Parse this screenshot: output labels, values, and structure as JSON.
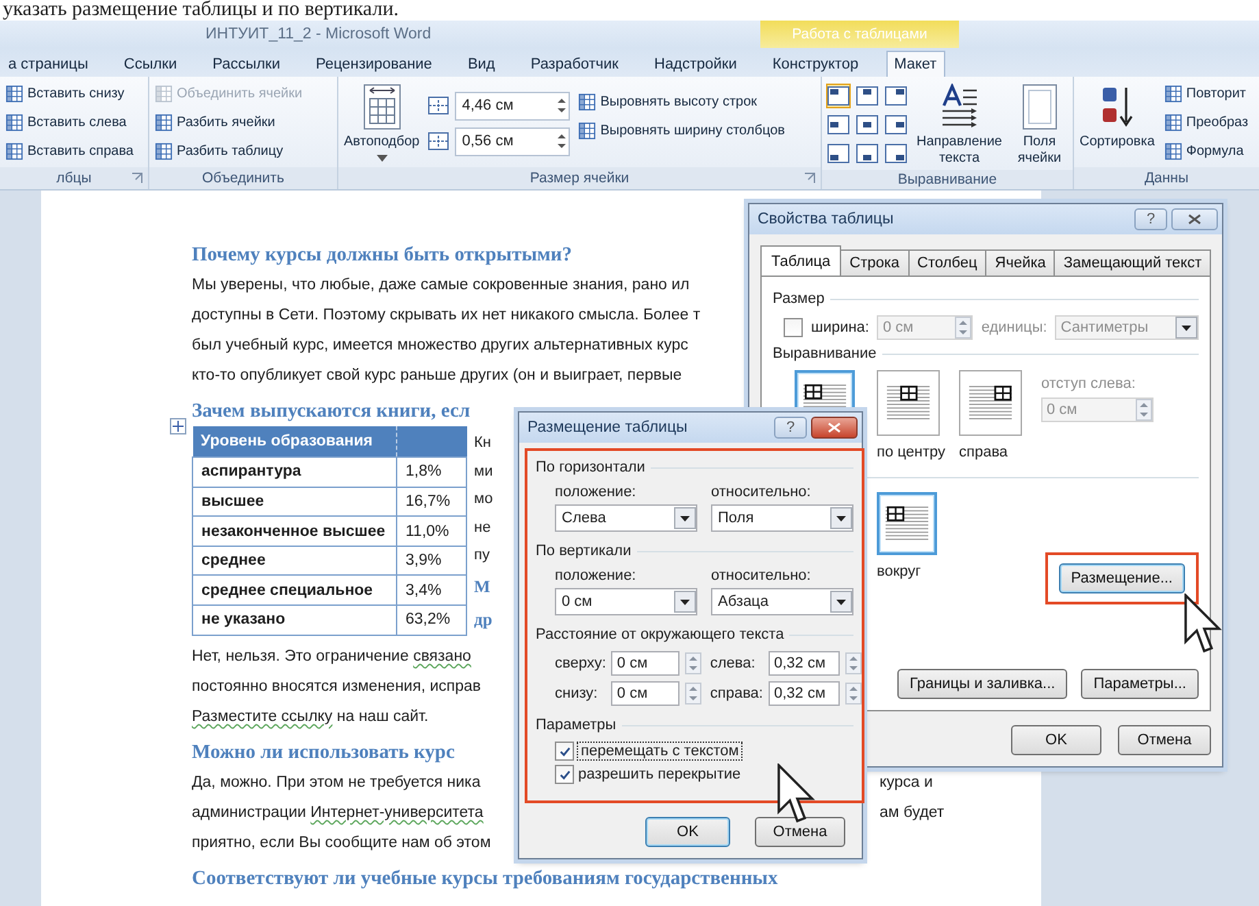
{
  "book_text": "указать размещение таблицы и по вертикали.",
  "window": {
    "title": "ИНТУИТ_11_2 - Microsoft Word",
    "context_group": "Работа с таблицами"
  },
  "tabs": [
    {
      "label": "а страницы",
      "selected": false
    },
    {
      "label": "Ссылки",
      "selected": false
    },
    {
      "label": "Рассылки",
      "selected": false
    },
    {
      "label": "Рецензирование",
      "selected": false
    },
    {
      "label": "Вид",
      "selected": false
    },
    {
      "label": "Разработчик",
      "selected": false
    },
    {
      "label": "Надстройки",
      "selected": false
    },
    {
      "label": "Конструктор",
      "selected": false
    },
    {
      "label": "Макет",
      "selected": true
    }
  ],
  "ribbon": {
    "groups": [
      {
        "label": "лбцы",
        "launcher": true,
        "columns": [
          [
            {
              "kind": "small",
              "label": "Вставить снизу",
              "disabled": false
            },
            {
              "kind": "small",
              "label": "Вставить слева",
              "disabled": false
            },
            {
              "kind": "small",
              "label": "Вставить справа",
              "disabled": false
            }
          ]
        ]
      },
      {
        "label": "Объединить",
        "launcher": false,
        "columns": [
          [
            {
              "kind": "small",
              "label": "Объединить ячейки",
              "disabled": true
            },
            {
              "kind": "small",
              "label": "Разбить ячейки",
              "disabled": false
            },
            {
              "kind": "small",
              "label": "Разбить таблицу",
              "disabled": false
            }
          ]
        ]
      },
      {
        "label": "Размер ячейки",
        "launcher": true,
        "columns": [
          [
            {
              "kind": "large",
              "label": "Автоподбор",
              "dropdown": true
            }
          ],
          [
            {
              "kind": "spinner",
              "value": "4,46 см"
            },
            {
              "kind": "spinner",
              "value": "0,56 см"
            }
          ],
          [
            {
              "kind": "small",
              "label": "Выровнять высоту строк",
              "disabled": false
            },
            {
              "kind": "small",
              "label": "Выровнять ширину столбцов",
              "disabled": false
            }
          ]
        ]
      },
      {
        "label": "Выравнивание",
        "launcher": false,
        "columns": [
          [
            {
              "kind": "align_grid",
              "cells": [
                {
                  "selected": true
                },
                {
                  "selected": false
                },
                {
                  "selected": false
                },
                {
                  "selected": false
                },
                {
                  "selected": false
                },
                {
                  "selected": false
                },
                {
                  "selected": false
                },
                {
                  "selected": false
                },
                {
                  "selected": false
                }
              ]
            }
          ],
          [
            {
              "kind": "large",
              "label": "Направление текста",
              "dropdown": false
            }
          ],
          [
            {
              "kind": "large",
              "label": "Поля ячейки",
              "dropdown": false
            }
          ]
        ]
      },
      {
        "label": "Данны",
        "launcher": false,
        "columns": [
          [
            {
              "kind": "large",
              "label": "Сортировка",
              "dropdown": false
            }
          ],
          [
            {
              "kind": "small",
              "label": "Повторит",
              "disabled": false
            },
            {
              "kind": "small",
              "label": "Преобраз",
              "disabled": false
            },
            {
              "kind": "small",
              "label": "Формула",
              "disabled": false
            }
          ]
        ]
      }
    ]
  },
  "document": {
    "blocks": [
      {
        "kind": "heading",
        "text": "Почему курсы должны быть открытыми?"
      },
      {
        "kind": "paragraph",
        "lines": [
          {
            "segments": [
              {
                "text": "Мы уверены, что любые, даже самые сокровенные знания, рано ил",
                "flagged": false
              }
            ]
          },
          {
            "segments": [
              {
                "text": "доступны в Сети. Поэтому скрывать их нет никакого смысла. Более т",
                "flagged": false
              }
            ]
          },
          {
            "segments": [
              {
                "text": "был учебный курс, имеется множество других альтернативных курс",
                "flagged": false
              }
            ]
          },
          {
            "segments": [
              {
                "text": "кто-то опубликует свой курс раньше других (он и выиграет, первые",
                "flagged": false
              }
            ]
          }
        ]
      },
      {
        "kind": "heading",
        "text": "Зачем выпускаются книги, есл"
      },
      {
        "kind": "table",
        "header": "Уровень образования",
        "rows": [
          {
            "label": "аспирантура",
            "value": "1,8%"
          },
          {
            "label": "высшее",
            "value": "16,7%"
          },
          {
            "label": "незаконченное высшее",
            "value": "11,0%"
          },
          {
            "label": "среднее",
            "value": "3,9%"
          },
          {
            "label": "среднее специальное",
            "value": "3,4%"
          },
          {
            "label": "не указано",
            "value": "63,2%"
          }
        ],
        "side_lines": [
          "Кн",
          "ми",
          "мо",
          "не",
          "пу"
        ],
        "side_heading": [
          "М",
          "др"
        ]
      },
      {
        "kind": "paragraph",
        "lines": [
          {
            "segments": [
              {
                "text": "Нет, нельзя. Это ограничение ",
                "flagged": false
              },
              {
                "text": "связано",
                "flagged": true
              }
            ]
          },
          {
            "segments": [
              {
                "text": "постоянно вносятся изменения, исправ",
                "flagged": false
              }
            ]
          },
          {
            "segments": [
              {
                "text": "Разместите ссылку",
                "flagged": true
              },
              {
                "text": " на наш сайт.",
                "flagged": false
              }
            ]
          }
        ]
      },
      {
        "kind": "heading",
        "text": "Можно ли использовать курс"
      },
      {
        "kind": "paragraph",
        "lines": [
          {
            "segments": [
              {
                "text": "Да, можно. При этом не требуется ника",
                "flagged": false
              }
            ],
            "right": "курса и"
          },
          {
            "segments": [
              {
                "text": "администрации ",
                "flagged": false
              },
              {
                "text": "Интернет-университета",
                "flagged": true
              }
            ],
            "right": "ам будет"
          },
          {
            "segments": [
              {
                "text": "приятно, если Вы сообщите нам об этом",
                "flagged": false
              }
            ]
          }
        ]
      },
      {
        "kind": "heading",
        "text": "Соответствуют ли учебные курсы требованиям государственных"
      }
    ]
  },
  "table_properties": {
    "title": "Свойства таблицы",
    "help": "?",
    "tabs": [
      {
        "label": "Таблица",
        "selected": true
      },
      {
        "label": "Строка",
        "selected": false
      },
      {
        "label": "Столбец",
        "selected": false
      },
      {
        "label": "Ячейка",
        "selected": false
      },
      {
        "label": "Замещающий текст",
        "selected": false
      }
    ],
    "size": {
      "label": "Размер",
      "width_checked": false,
      "width_label": "ширина:",
      "width_value": "0 см",
      "units_label": "единицы:",
      "units_value": "Сантиметры",
      "disabled": true
    },
    "alignment": {
      "label": "Выравнивание",
      "options": [
        {
          "selected": true
        },
        {
          "label": "по центру",
          "selected": false
        },
        {
          "label": "справа",
          "selected": false
        }
      ],
      "indent_label": "отступ слева:",
      "indent_value": "0 см",
      "indent_disabled": true
    },
    "wrapping": {
      "options": [
        {
          "label": "вокруг",
          "selected": true
        }
      ]
    },
    "buttons": {
      "positioning": "Размещение...",
      "borders": "Границы и заливка...",
      "options": "Параметры...",
      "ok": "OK",
      "cancel": "Отмена"
    }
  },
  "table_positioning": {
    "title": "Размещение таблицы",
    "help": "?",
    "horizontal": {
      "label": "По горизонтали",
      "position_label": "положение:",
      "position_value": "Слева",
      "relative_label": "относительно:",
      "relative_value": "Поля"
    },
    "vertical": {
      "label": "По вертикали",
      "position_label": "положение:",
      "position_value": "0 см",
      "relative_label": "относительно:",
      "relative_value": "Абзаца"
    },
    "distance": {
      "label": "Расстояние от окружающего текста",
      "fields": [
        {
          "label": "сверху:",
          "value": "0 см"
        },
        {
          "label": "слева:",
          "value": "0,32 см"
        },
        {
          "label": "снизу:",
          "value": "0 см"
        },
        {
          "label": "справа:",
          "value": "0,32 см"
        }
      ]
    },
    "options": {
      "label": "Параметры",
      "checkboxes": [
        {
          "label": "перемещать с текстом",
          "checked": true,
          "focused": true
        },
        {
          "label": "разрешить перекрытие",
          "checked": true,
          "focused": false
        }
      ]
    },
    "buttons": {
      "ok": "OK",
      "cancel": "Отмена"
    }
  }
}
